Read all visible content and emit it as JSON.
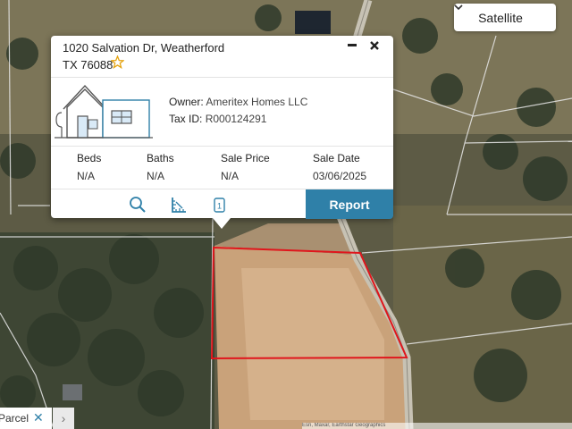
{
  "map": {
    "layer_button": {
      "label": "Satellite",
      "icon": "chevron-down-icon"
    },
    "parcel_outline_color": "#e0161c",
    "attribution": "Esri, Maxar, Earthstar Geographics"
  },
  "popup": {
    "address_line1": "1020 Salvation Dr, Weatherford",
    "address_line2": "TX 76088",
    "owner_label": "Owner:",
    "owner_value": "Ameritex Homes LLC",
    "tax_label": "Tax ID:",
    "tax_value": "R000124291",
    "stats": [
      {
        "label": "Beds",
        "value": "N/A"
      },
      {
        "label": "Baths",
        "value": "N/A"
      },
      {
        "label": "Sale Price",
        "value": "N/A"
      },
      {
        "label": "Sale Date",
        "value": "03/06/2025"
      }
    ],
    "report_label": "Report",
    "accent_color": "#2f80a8",
    "star_color": "#e5a412"
  },
  "footer": {
    "parcel_tab_label": "Parcel",
    "close_symbol": "✕",
    "next_symbol": "›"
  }
}
